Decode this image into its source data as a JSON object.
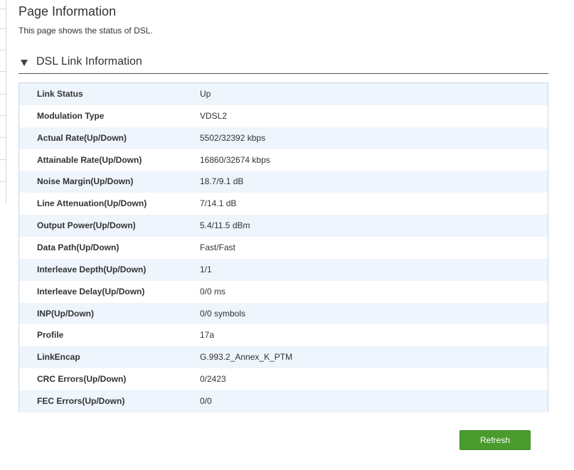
{
  "page": {
    "title": "Page Information",
    "description": "This page shows the status of DSL."
  },
  "section": {
    "title": "DSL Link Information",
    "icon": "triangle-down-icon"
  },
  "rows": [
    {
      "label": "Link Status",
      "value": "Up"
    },
    {
      "label": "Modulation Type",
      "value": "VDSL2"
    },
    {
      "label": "Actual Rate(Up/Down)",
      "value": "5502/32392 kbps"
    },
    {
      "label": "Attainable Rate(Up/Down)",
      "value": "16860/32674 kbps"
    },
    {
      "label": "Noise Margin(Up/Down)",
      "value": "18.7/9.1 dB"
    },
    {
      "label": "Line Attenuation(Up/Down)",
      "value": "7/14.1 dB"
    },
    {
      "label": "Output Power(Up/Down)",
      "value": "5.4/11.5 dBm"
    },
    {
      "label": "Data Path(Up/Down)",
      "value": "Fast/Fast"
    },
    {
      "label": "Interleave Depth(Up/Down)",
      "value": "1/1"
    },
    {
      "label": "Interleave Delay(Up/Down)",
      "value": "0/0 ms"
    },
    {
      "label": "INP(Up/Down)",
      "value": "0/0 symbols"
    },
    {
      "label": "Profile",
      "value": "17a"
    },
    {
      "label": "LinkEncap",
      "value": "G.993.2_Annex_K_PTM"
    },
    {
      "label": "CRC Errors(Up/Down)",
      "value": "0/2423"
    },
    {
      "label": "FEC Errors(Up/Down)",
      "value": "0/0"
    }
  ],
  "actions": {
    "refresh_label": "Refresh"
  },
  "colors": {
    "button": "#4a9a2e",
    "row_alt": "#eef5fc",
    "table_border": "#c9d8e6"
  }
}
